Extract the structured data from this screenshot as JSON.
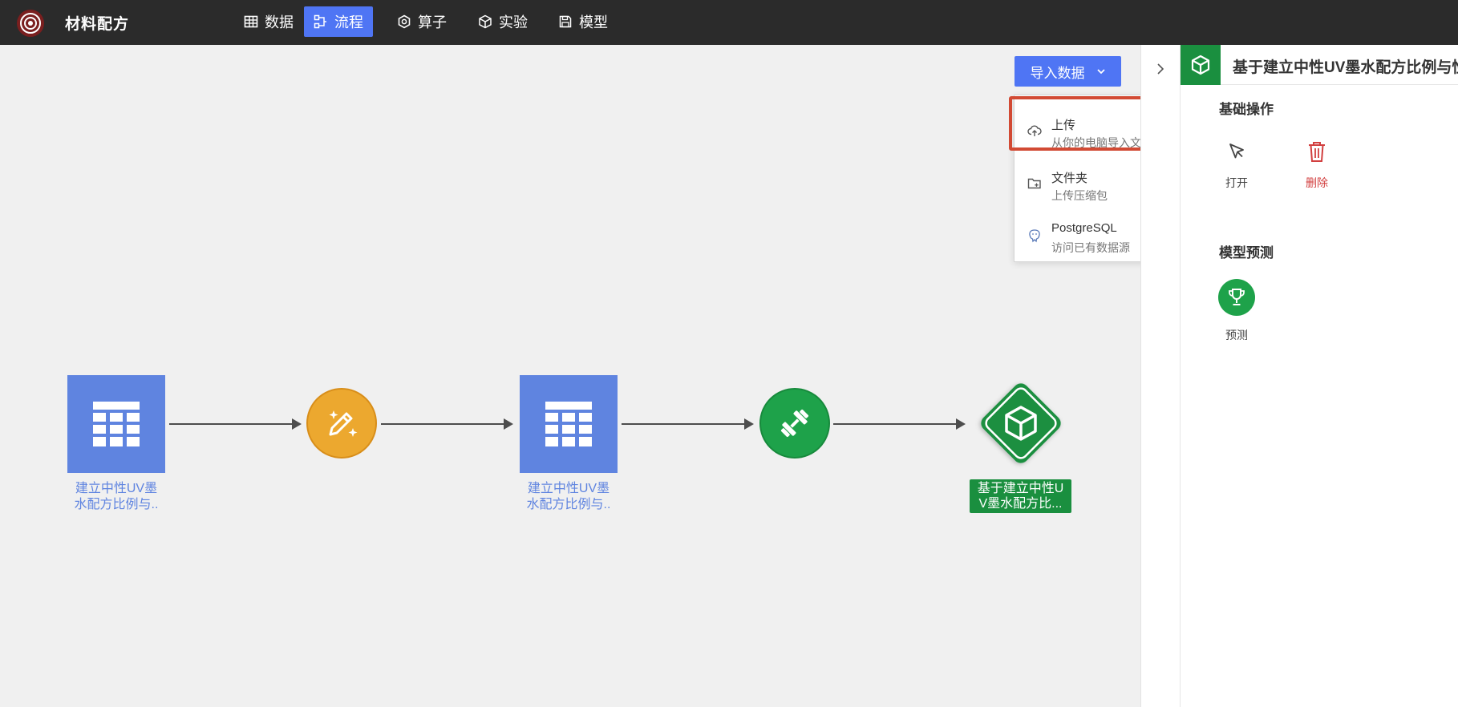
{
  "app": {
    "title": "材料配方"
  },
  "nav": {
    "items": [
      {
        "label": "数据",
        "icon": "table-icon"
      },
      {
        "label": "流程",
        "icon": "flow-icon",
        "active": true
      },
      {
        "label": "算子",
        "icon": "operator-icon"
      },
      {
        "label": "实验",
        "icon": "cube-icon"
      },
      {
        "label": "模型",
        "icon": "save-icon"
      }
    ]
  },
  "toolbar": {
    "import_label": "导入数据"
  },
  "import_menu": {
    "items": [
      {
        "label": "上传",
        "sub": "从你的电脑导入文件",
        "icon": "cloud-upload-icon"
      },
      {
        "label": "文件夹",
        "sub": "上传压缩包",
        "icon": "folder-plus-icon"
      },
      {
        "label": "PostgreSQL",
        "sub": "访问已有数据源",
        "icon": "postgresql-icon"
      }
    ]
  },
  "flow": {
    "nodes": [
      {
        "type": "dataset",
        "label_line1": "建立中性UV墨",
        "label_line2": "水配方比例与.."
      },
      {
        "type": "operator",
        "icon": "magic-pen-icon"
      },
      {
        "type": "dataset",
        "label_line1": "建立中性UV墨",
        "label_line2": "水配方比例与.."
      },
      {
        "type": "training",
        "icon": "dumbbell-icon"
      },
      {
        "type": "model",
        "label_line1": "基于建立中性U",
        "label_line2": "V墨水配方比..."
      }
    ]
  },
  "panel": {
    "title": "基于建立中性UV墨水配方比例与性",
    "basic_section": "基础操作",
    "open_label": "打开",
    "delete_label": "删除",
    "predict_section": "模型预测",
    "predict_label": "预测"
  },
  "colors": {
    "topbar": "#2b2b2b",
    "accent": "#4f75f4",
    "dataset": "#5f84e0",
    "operator": "#eca82f",
    "training": "#1ea24a",
    "model": "#1a8f3f",
    "danger": "#d23f3f",
    "highlight": "#d24a34"
  }
}
